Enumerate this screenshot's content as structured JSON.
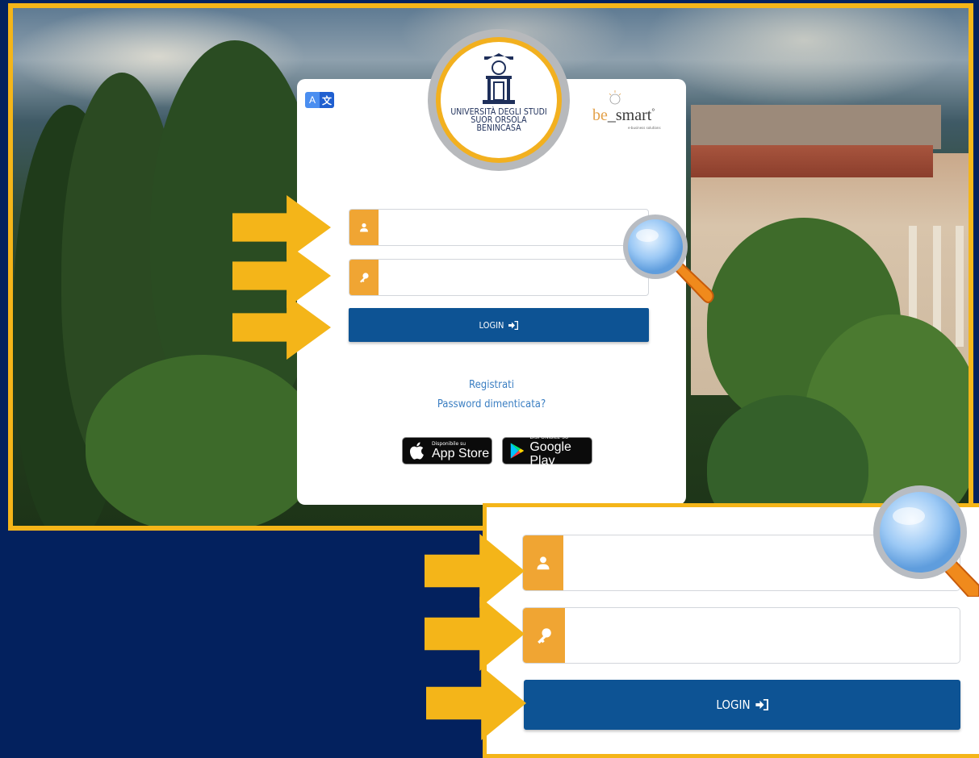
{
  "card": {
    "translate": {
      "label_a": "A",
      "label_b": "文"
    },
    "seal_lines": [
      "Università degli Studi",
      "Suor Orsola",
      "Benincasa"
    ],
    "brand": {
      "prefix": "be",
      "main": "smart",
      "mark": "°",
      "tagline": "e-business solutions"
    },
    "username_placeholder": "",
    "password_placeholder": "",
    "login_label": "LOGIN",
    "login_icon": "sign-in-icon",
    "register_link": "Registrati",
    "forgot_link": "Password dimenticata?",
    "app_store": {
      "small": "Disponibile su",
      "big": "App Store"
    },
    "google_play": {
      "small": "DISPONIBILE SU",
      "big": "Google Play"
    }
  },
  "zoom": {
    "username_placeholder": "",
    "password_placeholder": "",
    "login_label": "LOGIN"
  },
  "colors": {
    "frame": "#f4b519",
    "background": "#03215e",
    "icon_bg": "#f0a533",
    "button": "#0d5394",
    "link": "#3a7ec2"
  }
}
